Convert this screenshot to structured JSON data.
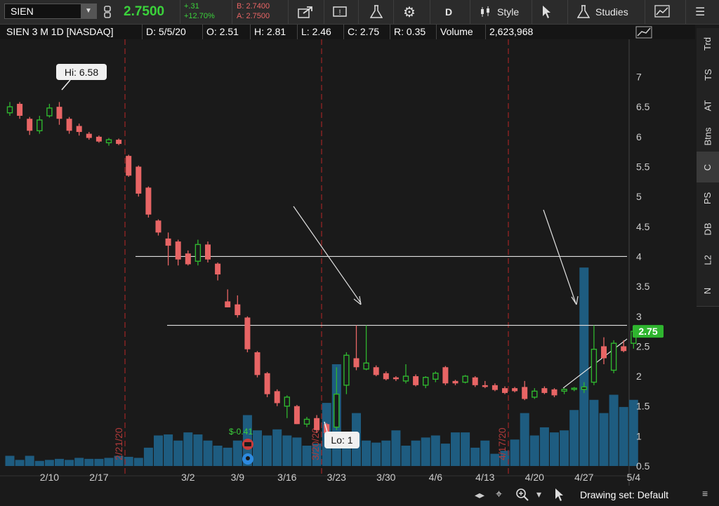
{
  "toolbar": {
    "symbol": "SIEN",
    "last_price": "2.7500",
    "change_abs": "+.31",
    "change_pct": "+12.70%",
    "bid": "B: 2.7400",
    "ask": "A: 2.7500",
    "period_label": "D",
    "style_label": "Style",
    "studies_label": "Studies"
  },
  "infobar": {
    "title": "SIEN 3 M 1D [NASDAQ]",
    "date": "D: 5/5/20",
    "open": "O: 2.51",
    "high": "H: 2.81",
    "low": "L: 2.46",
    "close": "C: 2.75",
    "range": "R: 0.35",
    "volume_label": "Volume",
    "volume_value": "2,623,968"
  },
  "right_tabs": [
    "Trd",
    "TS",
    "AT",
    "Btns",
    "C",
    "PS",
    "DB",
    "L2",
    "N"
  ],
  "bottom": {
    "drawing_set": "Drawing set: Default"
  },
  "colors": {
    "up": "#2fb52f",
    "down": "#e86565",
    "volume": "#1e5c80",
    "bg": "#1a1a1a"
  },
  "chart_data": {
    "type": "candlestick",
    "y_ticks": [
      "7",
      "6.5",
      "6",
      "5.5",
      "5",
      "4.5",
      "4",
      "3.5",
      "3",
      "2.5",
      "2",
      "1.5",
      "1",
      "0.5"
    ],
    "ylim": [
      0.2,
      7.3
    ],
    "x_ticks": [
      "2/10",
      "2/17",
      "3/2",
      "3/9",
      "3/16",
      "3/23",
      "3/30",
      "4/6",
      "4/13",
      "4/20",
      "4/27",
      "5/4"
    ],
    "vertical_markers": [
      "2/21/20",
      "3/20/20",
      "4/17/20"
    ],
    "annotations": {
      "high_label": "Hi: 6.58",
      "low_label": "Lo: 1",
      "price_badge": "2.75",
      "event_label": "$-0.41"
    },
    "horizontal_lines": [
      4.0,
      2.85
    ],
    "candles": [
      {
        "o": 6.4,
        "h": 6.58,
        "l": 6.35,
        "c": 6.5
      },
      {
        "o": 6.55,
        "h": 6.58,
        "l": 6.3,
        "c": 6.35
      },
      {
        "o": 6.3,
        "h": 6.33,
        "l": 6.03,
        "c": 6.1
      },
      {
        "o": 6.1,
        "h": 6.35,
        "l": 6.05,
        "c": 6.28
      },
      {
        "o": 6.35,
        "h": 6.55,
        "l": 6.32,
        "c": 6.48
      },
      {
        "o": 6.5,
        "h": 6.58,
        "l": 6.2,
        "c": 6.3
      },
      {
        "o": 6.3,
        "h": 6.33,
        "l": 6.05,
        "c": 6.1
      },
      {
        "o": 6.18,
        "h": 6.22,
        "l": 6.02,
        "c": 6.08
      },
      {
        "o": 6.05,
        "h": 6.08,
        "l": 5.95,
        "c": 5.98
      },
      {
        "o": 6.0,
        "h": 6.02,
        "l": 5.9,
        "c": 5.92
      },
      {
        "o": 5.9,
        "h": 5.98,
        "l": 5.85,
        "c": 5.95
      },
      {
        "o": 5.95,
        "h": 5.97,
        "l": 5.86,
        "c": 5.88
      },
      {
        "o": 5.68,
        "h": 5.7,
        "l": 5.33,
        "c": 5.35
      },
      {
        "o": 5.5,
        "h": 5.52,
        "l": 5.0,
        "c": 5.05
      },
      {
        "o": 5.15,
        "h": 5.17,
        "l": 4.65,
        "c": 4.7
      },
      {
        "o": 4.6,
        "h": 4.62,
        "l": 4.35,
        "c": 4.4
      },
      {
        "o": 4.3,
        "h": 4.4,
        "l": 3.85,
        "c": 4.18
      },
      {
        "o": 4.25,
        "h": 4.28,
        "l": 3.85,
        "c": 3.95
      },
      {
        "o": 4.05,
        "h": 4.1,
        "l": 3.85,
        "c": 3.87
      },
      {
        "o": 3.92,
        "h": 4.28,
        "l": 3.85,
        "c": 4.2
      },
      {
        "o": 4.2,
        "h": 4.25,
        "l": 3.9,
        "c": 3.95
      },
      {
        "o": 3.88,
        "h": 3.9,
        "l": 3.6,
        "c": 3.7
      },
      {
        "o": 3.25,
        "h": 3.45,
        "l": 3.15,
        "c": 3.15
      },
      {
        "o": 3.2,
        "h": 3.35,
        "l": 2.98,
        "c": 3.02
      },
      {
        "o": 2.98,
        "h": 3.0,
        "l": 2.4,
        "c": 2.45
      },
      {
        "o": 2.4,
        "h": 2.42,
        "l": 1.98,
        "c": 2.02
      },
      {
        "o": 2.05,
        "h": 2.07,
        "l": 1.65,
        "c": 1.7
      },
      {
        "o": 1.75,
        "h": 1.78,
        "l": 1.5,
        "c": 1.55
      },
      {
        "o": 1.5,
        "h": 1.68,
        "l": 1.3,
        "c": 1.65
      },
      {
        "o": 1.5,
        "h": 1.52,
        "l": 1.2,
        "c": 1.2
      },
      {
        "o": 1.2,
        "h": 1.32,
        "l": 1.15,
        "c": 1.28
      },
      {
        "o": 1.3,
        "h": 1.35,
        "l": 1.05,
        "c": 1.1
      },
      {
        "o": 1.2,
        "h": 1.22,
        "l": 1.0,
        "c": 1.05
      },
      {
        "o": 1.15,
        "h": 2.15,
        "l": 1.1,
        "c": 1.7
      },
      {
        "o": 1.85,
        "h": 2.4,
        "l": 1.7,
        "c": 2.35
      },
      {
        "o": 2.3,
        "h": 2.85,
        "l": 2.1,
        "c": 2.15
      },
      {
        "o": 2.12,
        "h": 2.85,
        "l": 2.1,
        "c": 2.22
      },
      {
        "o": 2.15,
        "h": 2.18,
        "l": 2.0,
        "c": 2.02
      },
      {
        "o": 2.05,
        "h": 2.08,
        "l": 1.93,
        "c": 1.95
      },
      {
        "o": 1.98,
        "h": 2.0,
        "l": 1.92,
        "c": 1.95
      },
      {
        "o": 1.92,
        "h": 2.2,
        "l": 1.88,
        "c": 2.0
      },
      {
        "o": 2.0,
        "h": 2.03,
        "l": 1.83,
        "c": 1.85
      },
      {
        "o": 1.85,
        "h": 2.0,
        "l": 1.8,
        "c": 1.98
      },
      {
        "o": 1.95,
        "h": 2.08,
        "l": 1.9,
        "c": 2.05
      },
      {
        "o": 2.15,
        "h": 2.17,
        "l": 1.85,
        "c": 1.88
      },
      {
        "o": 1.92,
        "h": 1.94,
        "l": 1.85,
        "c": 1.88
      },
      {
        "o": 1.9,
        "h": 2.02,
        "l": 1.88,
        "c": 2.0
      },
      {
        "o": 1.98,
        "h": 2.0,
        "l": 1.82,
        "c": 1.85
      },
      {
        "o": 1.85,
        "h": 1.92,
        "l": 1.8,
        "c": 1.82
      },
      {
        "o": 1.85,
        "h": 1.88,
        "l": 1.75,
        "c": 1.77
      },
      {
        "o": 1.8,
        "h": 1.83,
        "l": 1.7,
        "c": 1.72
      },
      {
        "o": 1.8,
        "h": 1.82,
        "l": 1.73,
        "c": 1.75
      },
      {
        "o": 1.82,
        "h": 1.92,
        "l": 1.6,
        "c": 1.62
      },
      {
        "o": 1.65,
        "h": 1.8,
        "l": 1.62,
        "c": 1.75
      },
      {
        "o": 1.8,
        "h": 1.83,
        "l": 1.7,
        "c": 1.72
      },
      {
        "o": 1.78,
        "h": 1.8,
        "l": 1.65,
        "c": 1.68
      },
      {
        "o": 1.75,
        "h": 1.8,
        "l": 1.7,
        "c": 1.78
      },
      {
        "o": 1.78,
        "h": 1.82,
        "l": 1.75,
        "c": 1.8
      },
      {
        "o": 1.78,
        "h": 1.9,
        "l": 1.72,
        "c": 1.82
      },
      {
        "o": 1.9,
        "h": 2.85,
        "l": 1.85,
        "c": 2.45
      },
      {
        "o": 2.5,
        "h": 2.65,
        "l": 2.2,
        "c": 2.3
      },
      {
        "o": 2.1,
        "h": 2.6,
        "l": 2.05,
        "c": 2.55
      },
      {
        "o": 2.5,
        "h": 2.6,
        "l": 2.4,
        "c": 2.42
      },
      {
        "o": 2.55,
        "h": 2.81,
        "l": 2.46,
        "c": 2.75
      }
    ],
    "volume": [
      0.1,
      0.06,
      0.1,
      0.05,
      0.06,
      0.07,
      0.06,
      0.08,
      0.07,
      0.07,
      0.08,
      0.1,
      0.09,
      0.08,
      0.18,
      0.3,
      0.31,
      0.25,
      0.33,
      0.31,
      0.25,
      0.2,
      0.18,
      0.25,
      0.5,
      0.35,
      0.3,
      0.36,
      0.3,
      0.28,
      0.2,
      0.22,
      0.62,
      1.0,
      0.25,
      0.52,
      0.25,
      0.23,
      0.25,
      0.35,
      0.2,
      0.25,
      0.28,
      0.3,
      0.22,
      0.33,
      0.33,
      0.18,
      0.25,
      0.12,
      0.15,
      0.26,
      0.52,
      0.3,
      0.38,
      0.33,
      0.35,
      0.55,
      1.95,
      0.65,
      0.52,
      0.7,
      0.58,
      0.65
    ]
  }
}
